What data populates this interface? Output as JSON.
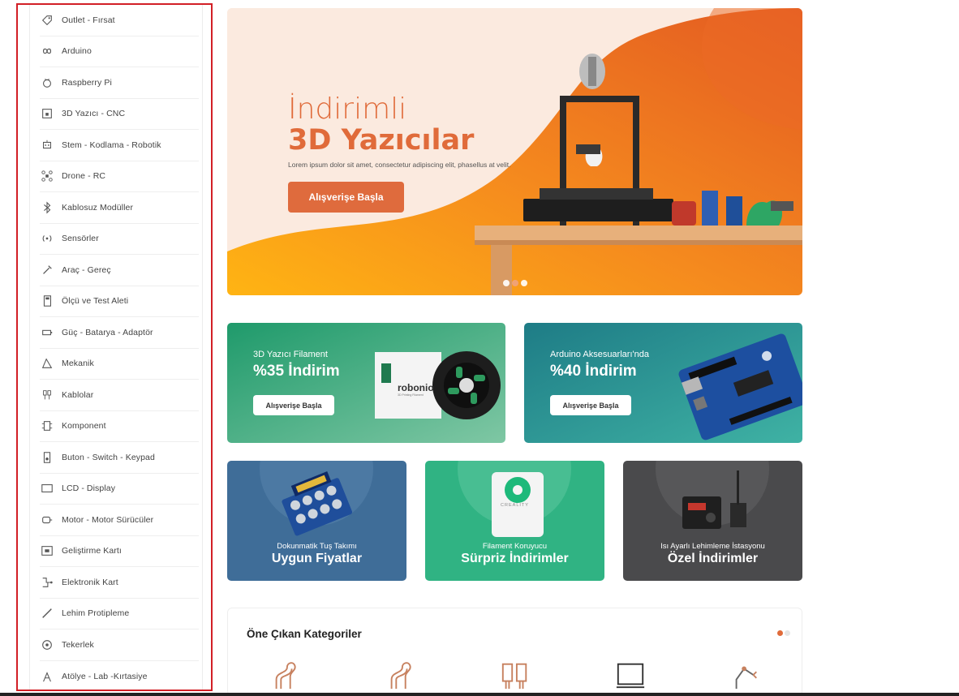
{
  "sidebar": {
    "items": [
      {
        "label": "Outlet - Fırsat",
        "icon": "tag-icon"
      },
      {
        "label": "Arduino",
        "icon": "infinity-icon"
      },
      {
        "label": "Raspberry Pi",
        "icon": "raspberry-icon"
      },
      {
        "label": "3D Yazıcı - CNC",
        "icon": "printer-3d-icon"
      },
      {
        "label": "Stem - Kodlama - Robotik",
        "icon": "robot-icon"
      },
      {
        "label": "Drone - RC",
        "icon": "drone-icon"
      },
      {
        "label": "Kablosuz Modüller",
        "icon": "bluetooth-icon"
      },
      {
        "label": "Sensörler",
        "icon": "sensor-icon"
      },
      {
        "label": "Araç - Gereç",
        "icon": "tools-icon"
      },
      {
        "label": "Ölçü ve Test Aleti",
        "icon": "multimeter-icon"
      },
      {
        "label": "Güç - Batarya - Adaptör",
        "icon": "battery-icon"
      },
      {
        "label": "Mekanik",
        "icon": "mechanic-icon"
      },
      {
        "label": "Kablolar",
        "icon": "cable-icon"
      },
      {
        "label": "Komponent",
        "icon": "component-icon"
      },
      {
        "label": "Buton - Switch - Keypad",
        "icon": "button-icon"
      },
      {
        "label": "LCD - Display",
        "icon": "display-icon"
      },
      {
        "label": "Motor - Motor Sürücüler",
        "icon": "motor-icon"
      },
      {
        "label": "Geliştirme Kartı",
        "icon": "board-icon"
      },
      {
        "label": "Elektronik Kart",
        "icon": "circuit-icon"
      },
      {
        "label": "Lehim Protipleme",
        "icon": "solder-icon"
      },
      {
        "label": "Tekerlek",
        "icon": "wheel-icon"
      },
      {
        "label": "Atölye - Lab -Kırtasiye",
        "icon": "workshop-icon"
      }
    ]
  },
  "hero": {
    "title_light": "İndirimli",
    "title_bold": "3D Yazıcılar",
    "subtitle": "Lorem ipsum dolor sit amet, consectetur adipiscing elit, phasellus at velit.",
    "button": "Alışverişe Başla",
    "colors": {
      "accent": "#e06b3a",
      "bg": "#fbe9dd"
    }
  },
  "promos": [
    {
      "subtitle": "3D Yazıcı Filament",
      "title": "%35 İndirim",
      "button": "Alışverişe Başla",
      "brand": "robonio",
      "brand_sub": "3D Printing Filament"
    },
    {
      "subtitle": "Arduino Aksesuarları'nda",
      "title": "%40 İndirim",
      "button": "Alışverişe Başla"
    }
  ],
  "cards": [
    {
      "subtitle": "Dokunmatik Tuş Takımı",
      "title": "Uygun Fiyatlar"
    },
    {
      "subtitle": "Filament Koruyucu",
      "title": "Sürpriz İndirimler",
      "brand": "CREALITY"
    },
    {
      "subtitle": "Isı Ayarlı Lehimleme İstasyonu",
      "title": "Özel İndirimler"
    }
  ],
  "featured": {
    "title": "Öne Çıkan Kategoriler"
  }
}
